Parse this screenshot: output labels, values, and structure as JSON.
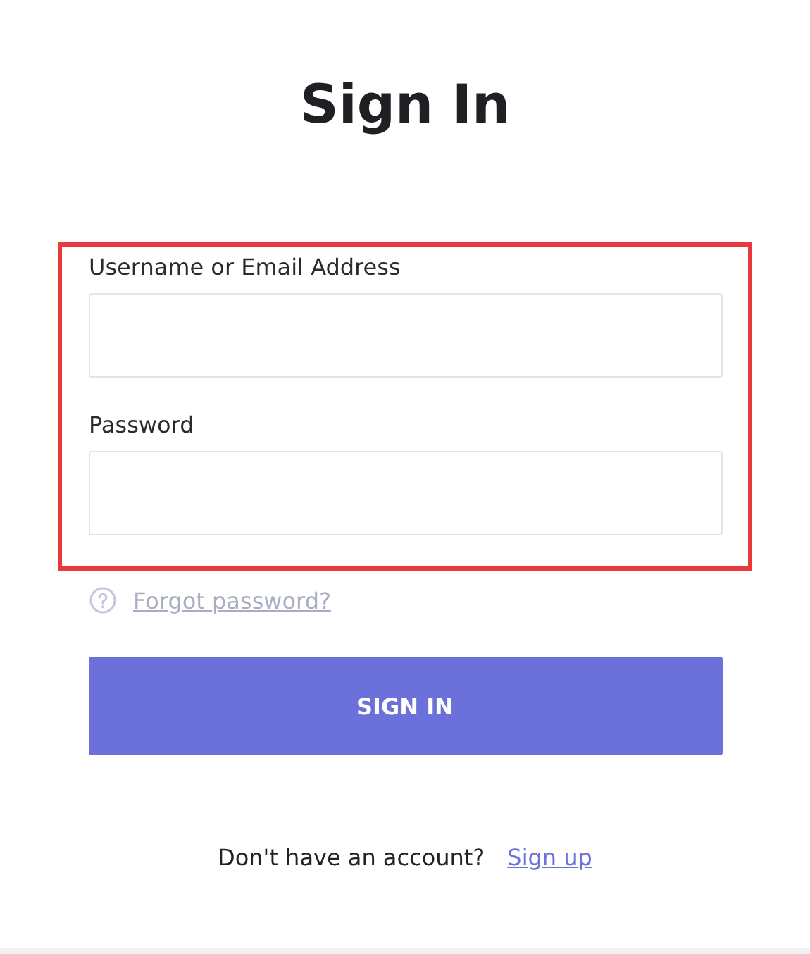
{
  "title": "Sign In",
  "highlighted": true,
  "fields": [
    {
      "label": "Username or Email Address"
    },
    {
      "label": "Password"
    }
  ],
  "forgot_link": "Forgot password?",
  "submit_button": "SIGN IN",
  "footer": {
    "text": "Don't have an account?",
    "link": "Sign up"
  }
}
